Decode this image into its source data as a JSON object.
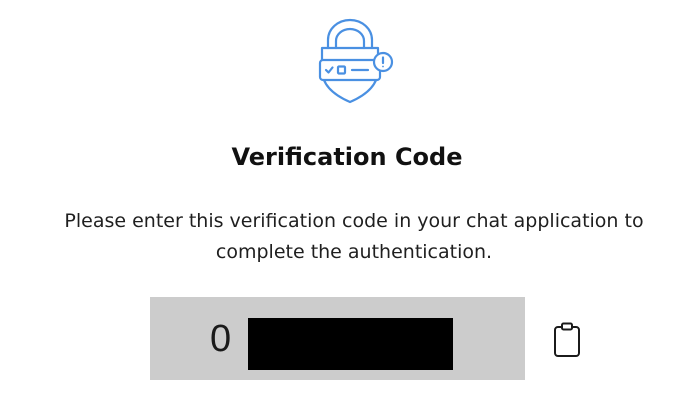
{
  "header": {
    "icon": "shield-lock-code-icon",
    "accent_color": "#4a90e2",
    "title": "Verification Code"
  },
  "body": {
    "description_line1": "Please enter this verification code in your chat application to",
    "description_line2": "complete the authentication."
  },
  "code": {
    "visible_prefix": "0",
    "redacted": true,
    "box_color": "#cccccc"
  },
  "actions": {
    "copy_icon": "clipboard-icon"
  }
}
